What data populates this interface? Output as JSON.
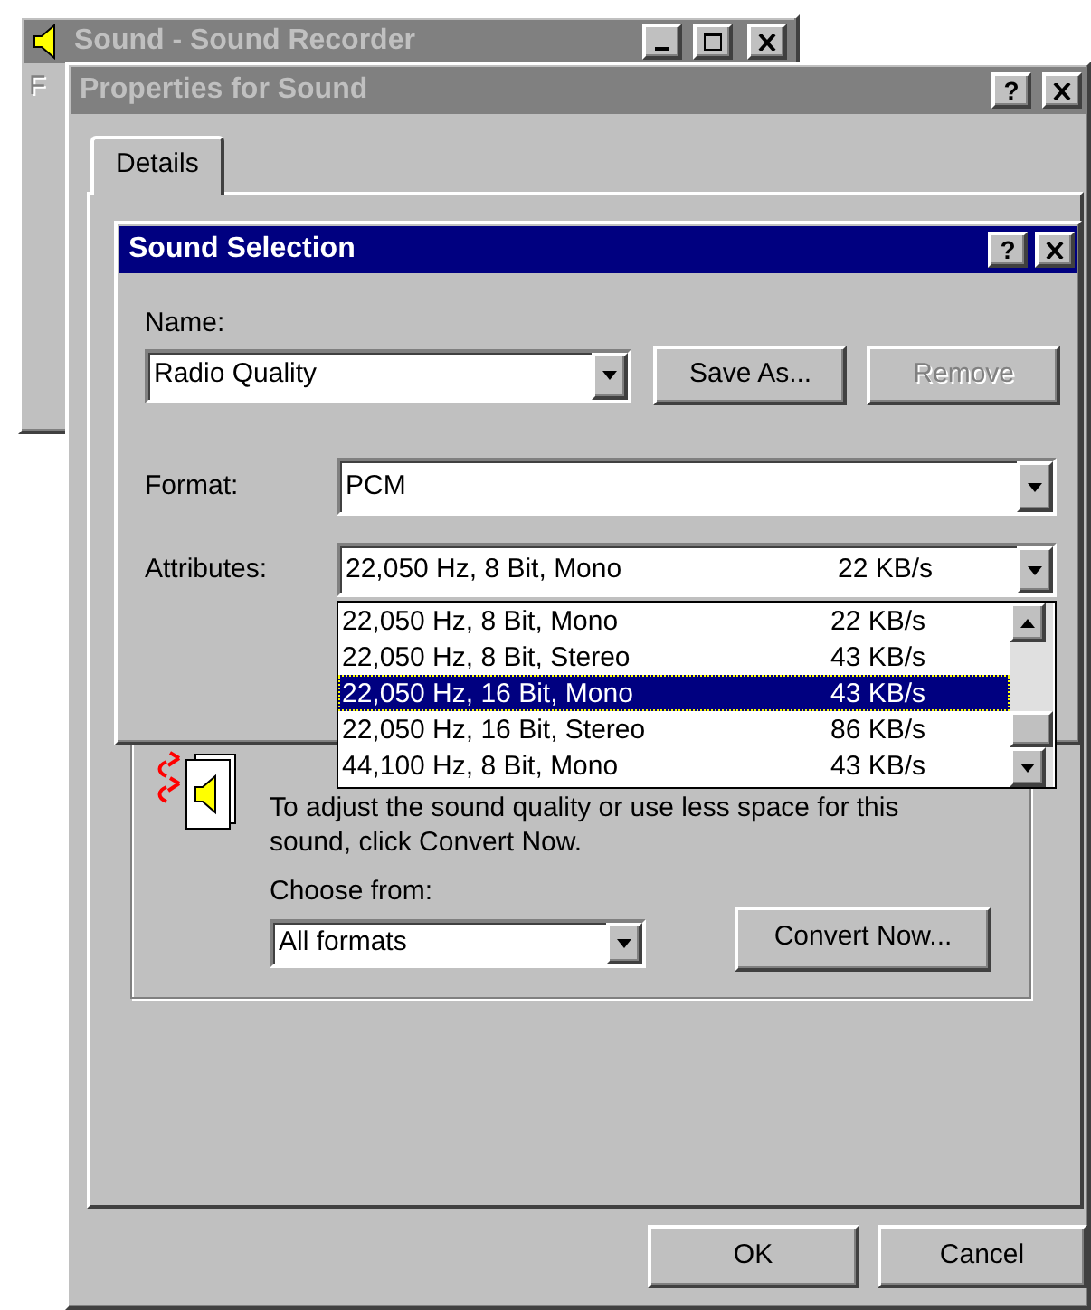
{
  "recorder_window": {
    "title": "Sound - Sound Recorder",
    "active": false,
    "menu": [
      "F"
    ]
  },
  "properties_window": {
    "title": "Properties for Sound",
    "active": false,
    "help_button": "?",
    "tabs": [
      {
        "label": "Details",
        "selected": true
      }
    ],
    "convert_panel": {
      "text": "To adjust the sound quality or use less space for this sound, click Convert Now.",
      "choose_label": "Choose from:",
      "choose_value": "All formats",
      "convert_button": "Convert Now..."
    },
    "buttons": [
      {
        "label": "OK"
      },
      {
        "label": "Cancel"
      }
    ]
  },
  "dialog": {
    "title": "Sound Selection",
    "active": true,
    "help_button": "?",
    "name_label": "Name:",
    "name_value": "Radio Quality",
    "buttons": [
      {
        "label": "Save As...",
        "disabled": false
      },
      {
        "label": "Remove",
        "disabled": true
      }
    ],
    "format_label": "Format:",
    "format_value": "PCM",
    "attributes_label": "Attributes:",
    "attributes_value": {
      "format": "22,050 Hz, 8 Bit, Mono",
      "rate": "22 KB/s"
    },
    "attributes_list": [
      {
        "format": "22,050 Hz, 8 Bit, Mono",
        "rate": "22 KB/s",
        "selected": false
      },
      {
        "format": "22,050 Hz, 8 Bit, Stereo",
        "rate": "43 KB/s",
        "selected": false
      },
      {
        "format": "22,050 Hz, 16 Bit, Mono",
        "rate": "43 KB/s",
        "selected": true
      },
      {
        "format": "22,050 Hz, 16 Bit, Stereo",
        "rate": "86 KB/s",
        "selected": false
      },
      {
        "format": "44,100 Hz, 8 Bit, Mono",
        "rate": "43 KB/s",
        "selected": false
      }
    ]
  }
}
